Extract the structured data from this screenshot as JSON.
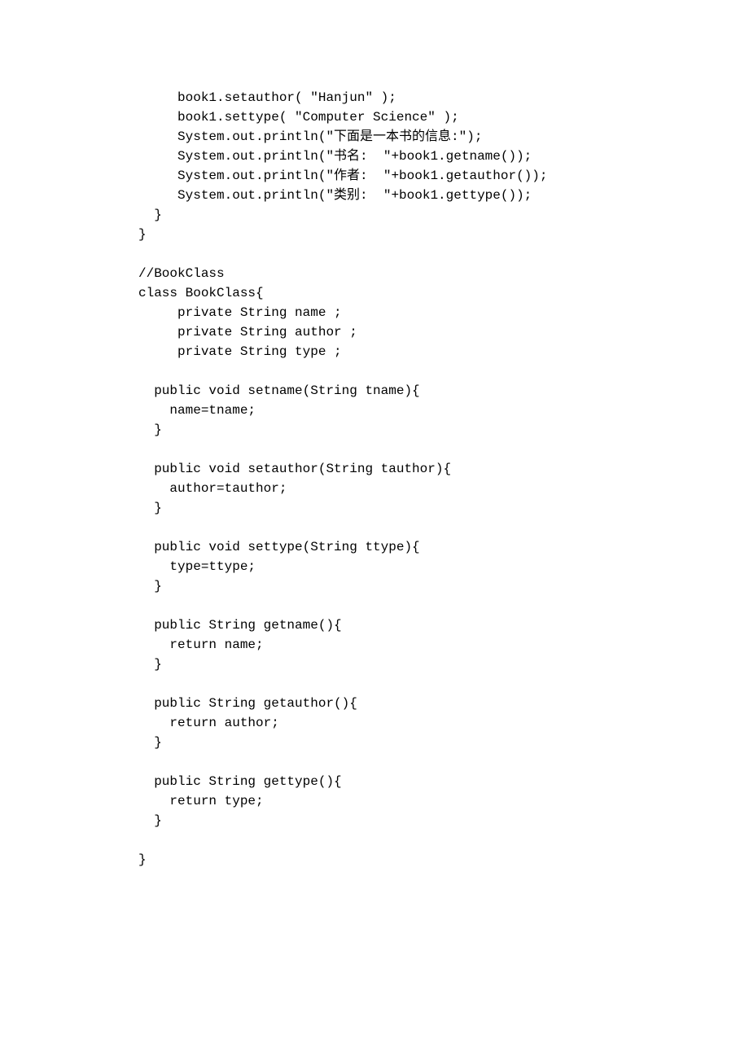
{
  "code": {
    "lines": [
      "     book1.setauthor( \"Hanjun\" );",
      "     book1.settype( \"Computer Science\" );",
      "     System.out.println(\"下面是一本书的信息:\");",
      "     System.out.println(\"书名:  \"+book1.getname());",
      "     System.out.println(\"作者:  \"+book1.getauthor());",
      "     System.out.println(\"类别:  \"+book1.gettype());",
      "  }",
      "}",
      "",
      "//BookClass",
      "class BookClass{",
      "     private String name ;",
      "     private String author ;",
      "     private String type ;",
      "",
      "  public void setname(String tname){",
      "    name=tname;",
      "  }",
      "",
      "  public void setauthor(String tauthor){",
      "    author=tauthor;",
      "  }",
      "",
      "  public void settype(String ttype){",
      "    type=ttype;",
      "  }",
      "",
      "  public String getname(){",
      "    return name;",
      "  }",
      "",
      "  public String getauthor(){",
      "    return author;",
      "  }",
      "",
      "  public String gettype(){",
      "    return type;",
      "  }",
      "",
      "}"
    ]
  }
}
